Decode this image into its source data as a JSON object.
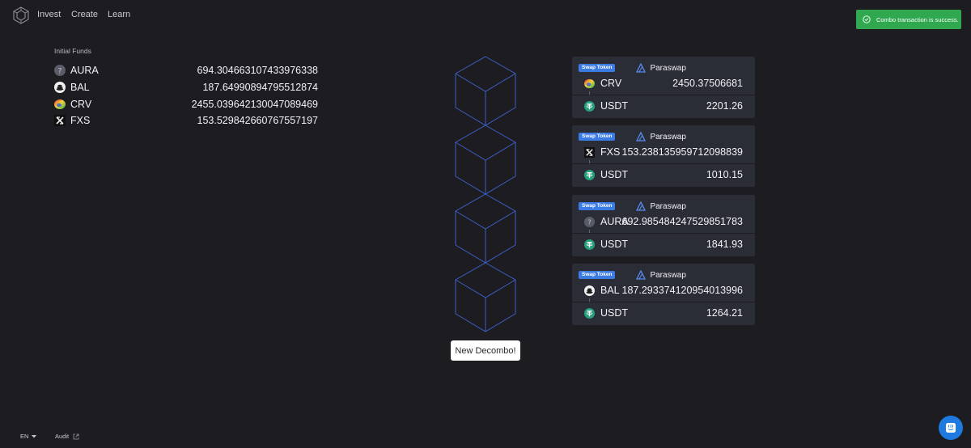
{
  "nav": {
    "links": [
      "Invest",
      "Create",
      "Learn"
    ]
  },
  "toast": {
    "message": "Combo transaction is success."
  },
  "funds": {
    "title": "Initial Funds",
    "items": [
      {
        "symbol": "AURA",
        "amount": "694.304663107433976338",
        "icon": "aura-token-icon"
      },
      {
        "symbol": "BAL",
        "amount": "187.64990894795512874",
        "icon": "bal-token-icon"
      },
      {
        "symbol": "CRV",
        "amount": "2455.039642130047089469",
        "icon": "crv-token-icon"
      },
      {
        "symbol": "FXS",
        "amount": "153.529842660767557197",
        "icon": "fxs-token-icon"
      }
    ]
  },
  "swaps": [
    {
      "badge": "Swap Token",
      "provider": "Paraswap",
      "from_symbol": "CRV",
      "from_amount": "2450.37506681",
      "to_symbol": "USDT",
      "to_amount": "2201.26"
    },
    {
      "badge": "Swap Token",
      "provider": "Paraswap",
      "from_symbol": "FXS",
      "from_amount": "153.238135959712098839",
      "to_symbol": "USDT",
      "to_amount": "1010.15"
    },
    {
      "badge": "Swap Token",
      "provider": "Paraswap",
      "from_symbol": "AURA",
      "from_amount": "692.985484247529851783",
      "to_symbol": "USDT",
      "to_amount": "1841.93"
    },
    {
      "badge": "Swap Token",
      "provider": "Paraswap",
      "from_symbol": "BAL",
      "from_amount": "187.293374120954013996",
      "to_symbol": "USDT",
      "to_amount": "1264.21"
    }
  ],
  "arrow_glyph": "↓",
  "new_button": "New Decombo!",
  "footer": {
    "language": "EN",
    "audit": "Audit"
  },
  "colors": {
    "background": "#1c1c21",
    "card": "#2a2c36",
    "toast": "#2fa84f",
    "badge": "#3b7be3",
    "cube_stroke": "#3d5fc4",
    "chat": "#1f7ae0"
  }
}
